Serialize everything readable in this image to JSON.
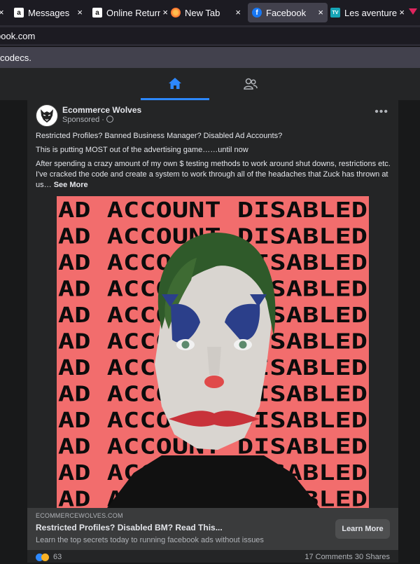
{
  "browser": {
    "tabs": [
      {
        "label": "",
        "favicon": "amazon-favicon"
      },
      {
        "label": "Messages",
        "favicon": "amazon-favicon"
      },
      {
        "label": "Online Return",
        "favicon": "amazon-favicon"
      },
      {
        "label": "New Tab",
        "favicon": "firefox-icon"
      },
      {
        "label": "Facebook",
        "favicon": "facebook-favicon",
        "active": true
      },
      {
        "label": "Les aventures",
        "favicon": "tv-favicon"
      }
    ],
    "url": "book.com",
    "notice": "codecs."
  },
  "fb_nav": {
    "home_icon": "home-icon",
    "groups_icon": "friends-icon"
  },
  "post": {
    "page_name": "Ecommerce Wolves",
    "sponsored": "Sponsored ·",
    "menu": "•••",
    "line1": "Restricted Profiles? Banned Business Manager? Disabled Ad Accounts?",
    "line2": "This is putting MOST out of the advertising game……until now",
    "body": "After spending a crazy amount of my own $ testing methods to work around shut downs, restrictions etc. I've cracked the code and create a system to work through all of the headaches that Zuck has thrown at us…",
    "see_more": "See More",
    "image_text": "AD ACCOUNT DISABLED",
    "link": {
      "domain": "ECOMMERCEWOLVES.COM",
      "headline": "Restricted Profiles? Disabled BM? Read This...",
      "description": "Learn the top secrets today to running facebook ads without issues",
      "cta": "Learn More"
    },
    "reactions_count": "63",
    "stats": "17 Comments 30 Shares"
  },
  "colors": {
    "accent": "#2d88ff",
    "image_bg": "#f26d6d"
  }
}
